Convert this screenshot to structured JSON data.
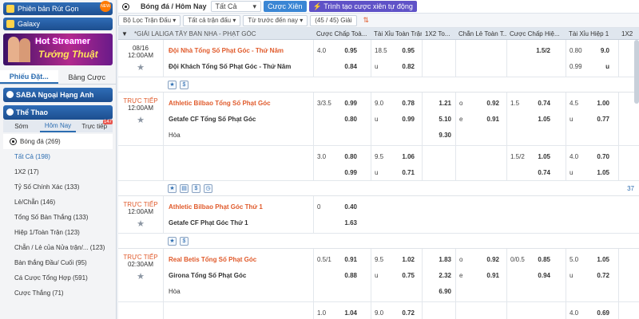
{
  "sidebar": {
    "pill1": "Phiên bản Rút Gọn",
    "pill2": "Galaxy",
    "new_badge": "NEW",
    "banner": {
      "line1": "Hot Streamer",
      "line2": "Tướng Thuật"
    },
    "tab_bets": "Phiếu Đặt...",
    "tab_statement": "Bảng Cược",
    "group1": "SABA Ngoại Hạng Anh",
    "group2": "Thể Thao",
    "subtabs": [
      "Sớm",
      "Hôm Nay",
      "Trực tiếp"
    ],
    "live_count": "147",
    "sport": "Bóng đá  (269)",
    "markets": [
      "Tất Cả (198)",
      "1X2 (17)",
      "Tỷ Số Chính Xác (133)",
      "Lẻ/Chẵn (146)",
      "Tổng Số Bàn Thắng (133)",
      "Hiệp 1/Toàn Trận (123)",
      "Chẵn / Lẻ của Nửa trận/...  (123)",
      "Bàn thắng Đầu/ Cuối (95)",
      "Cá Cược Tổng Hợp (591)",
      "Cược Thắng (71)"
    ]
  },
  "topbar": {
    "title": "Bóng đá / Hôm Nay",
    "filter_all": "Tất Cả",
    "btn_parlay": "Cược Xiên",
    "btn_auto": "Trình tạo cược xiên tự động"
  },
  "filters": {
    "league": "Bộ Lọc Trận Đấu",
    "matches": "Tất cả trận đấu",
    "sort": "Từ trước đến nay",
    "count": "(45 / 45) Giải"
  },
  "header": {
    "league": "*GIẢI LALIGA TÂY BAN NHA - PHẠT GÓC",
    "cols": [
      "Cược Chấp Toà...",
      "Tài Xỉu Toàn Trận",
      "1X2 To...",
      "Chẵn Lẻ Toàn T...",
      "Cược Chấp Hiệ...",
      "Tài Xỉu Hiệp 1",
      "1X2"
    ]
  },
  "matches": [
    {
      "time": "08/16",
      "time2": "12:00AM",
      "live": false,
      "home": "Đội Nhà Tổng Số Phạt Góc - Thứ Năm",
      "away": "Đội Khách Tổng Số Phạt Góc - Thứ Năm",
      "draw": "",
      "odds": [
        [
          "4.0",
          "0.95",
          "18.5",
          "0.95",
          "",
          "",
          "",
          "",
          "1.5/2",
          "0.80",
          "9.0",
          "1.00"
        ],
        [
          "",
          "0.84",
          "u",
          "0.82",
          "",
          "",
          "",
          "",
          "",
          "0.99",
          "u",
          "0.77"
        ]
      ]
    },
    {
      "time": "TRỰC TIẾP",
      "time2": "12:00AM",
      "live": true,
      "home": "Athletic Bilbao Tổng Số Phạt Góc",
      "away": "Getafe CF Tổng Số Phạt Góc",
      "draw": "Hòa",
      "odds": [
        [
          "3/3.5",
          "0.99",
          "9.0",
          "0.78",
          "1.21",
          "o",
          "0.92",
          "1.5",
          "0.74",
          "4.5",
          "1.00"
        ],
        [
          "",
          "0.80",
          "u",
          "0.99",
          "5.10",
          "e",
          "0.91",
          "",
          "1.05",
          "u",
          "0.77"
        ],
        [
          "",
          "",
          "",
          "",
          "9.30",
          "",
          "",
          "",
          "",
          "",
          ""
        ]
      ],
      "sub": [
        [
          "3.0",
          "0.80",
          "9.5",
          "1.06",
          "1.5/2",
          "1.05",
          "4.0",
          "0.70"
        ],
        [
          "",
          "0.99",
          "u",
          "0.71",
          "",
          "0.74",
          "u",
          "1.05"
        ]
      ]
    },
    {
      "time": "TRỰC TIẾP",
      "time2": "12:00AM",
      "live": true,
      "home": "Athletic Bilbao Phạt Góc Thứ 1",
      "away": "Getafe CF Phạt Góc Thứ 1",
      "draw": "",
      "odds": [
        [
          "0",
          "0.40"
        ],
        [
          "",
          "1.63"
        ]
      ]
    },
    {
      "time": "TRỰC TIẾP",
      "time2": "02:30AM",
      "live": true,
      "home": "Real Betis Tổng Số Phạt Góc",
      "away": "Girona Tổng Số Phạt Góc",
      "draw": "Hòa",
      "odds": [
        [
          "0.5/1",
          "0.91",
          "9.5",
          "1.02",
          "1.83",
          "o",
          "0.92",
          "0/0.5",
          "0.85",
          "5.0",
          "1.05"
        ],
        [
          "",
          "0.88",
          "u",
          "0.75",
          "2.32",
          "e",
          "0.91",
          "",
          "0.94",
          "u",
          "0.72"
        ],
        [
          "",
          "",
          "",
          "",
          "6.90",
          "",
          "",
          "",
          "",
          "",
          ""
        ]
      ],
      "sub": [
        [
          "1.0",
          "1.04",
          "9.0",
          "0.72",
          "",
          "",
          "4.0",
          "0.69"
        ]
      ]
    }
  ],
  "more_count": "37"
}
